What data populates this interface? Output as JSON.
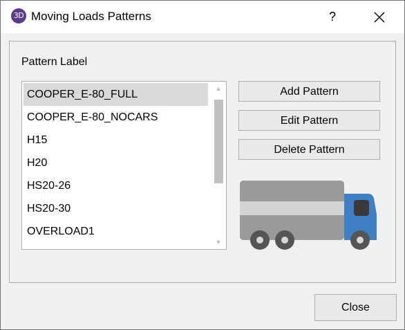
{
  "window": {
    "app_icon_text": "3D",
    "title": "Moving Loads Patterns",
    "help_label": "?"
  },
  "group": {
    "label": "Pattern Label"
  },
  "patterns": {
    "items": [
      "COOPER_E-80_FULL",
      "COOPER_E-80_NOCARS",
      "H15",
      "H20",
      "HS20-26",
      "HS20-30",
      "OVERLOAD1"
    ],
    "selected": "COOPER_E-80_FULL"
  },
  "actions": {
    "add_label": "Add Pattern",
    "edit_label": "Edit Pattern",
    "delete_label": "Delete Pattern"
  },
  "footer": {
    "close_label": "Close"
  },
  "colors": {
    "truck_body": "#9a9a9a",
    "truck_stripe": "#d3d3d3",
    "truck_cab": "#3f7fc4",
    "wheel": "#555555"
  }
}
